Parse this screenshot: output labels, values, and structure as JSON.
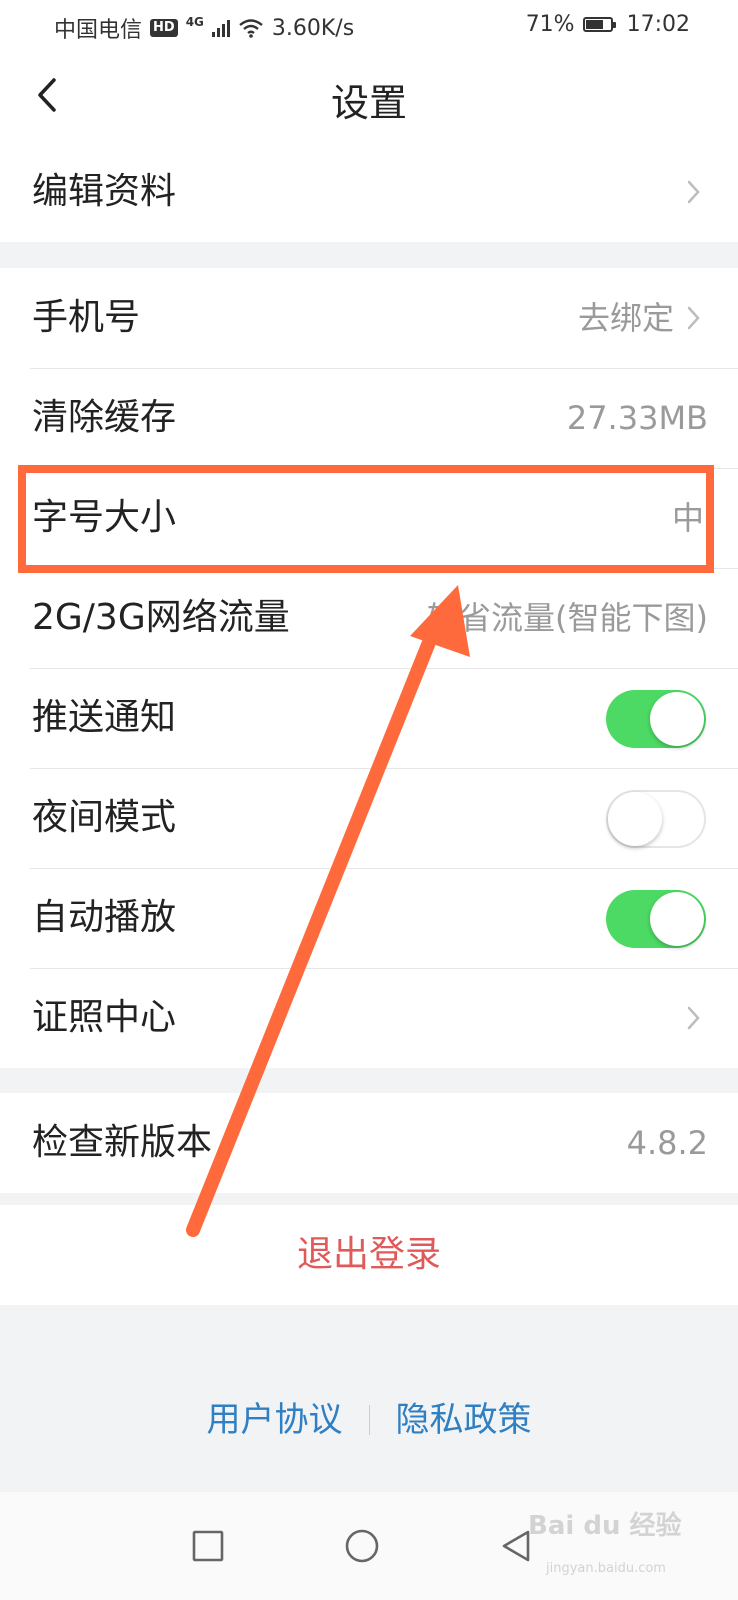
{
  "status_bar": {
    "carrier": "中国电信",
    "hd": "HD",
    "network": "4G",
    "speed": "3.60K/s",
    "battery_percent": "71%",
    "battery_level": 0.71,
    "time": "17:02"
  },
  "header": {
    "title": "设置",
    "back_icon": "chevron-left-icon"
  },
  "settings": {
    "edit_profile": {
      "label": "编辑资料"
    },
    "phone": {
      "label": "手机号",
      "value": "去绑定"
    },
    "clear_cache": {
      "label": "清除缓存",
      "value": "27.33MB"
    },
    "font_size": {
      "label": "字号大小",
      "value": "中"
    },
    "network_traffic": {
      "label": "2G/3G网络流量",
      "value": "较省流量(智能下图)"
    },
    "push_notifications": {
      "label": "推送通知",
      "enabled": true
    },
    "night_mode": {
      "label": "夜间模式",
      "enabled": false
    },
    "autoplay": {
      "label": "自动播放",
      "enabled": true
    },
    "license_center": {
      "label": "证照中心"
    },
    "check_version": {
      "label": "检查新版本",
      "value": "4.8.2"
    }
  },
  "logout": {
    "label": "退出登录"
  },
  "footer": {
    "user_agreement": "用户协议",
    "privacy_policy": "隐私政策"
  },
  "colors": {
    "toggle_on": "#4cd964",
    "logout_text": "#e05a5a",
    "link": "#2f7fc2",
    "annotation": "#ff6a3d"
  },
  "watermark": {
    "brand": "Bai du 经验",
    "domain": "jingyan.baidu.com"
  }
}
